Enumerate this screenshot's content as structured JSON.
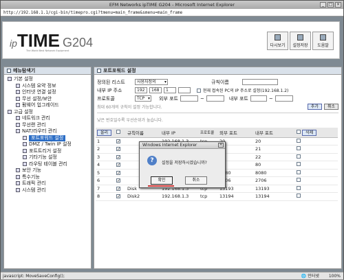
{
  "window": {
    "title": "EFM Networks ipTIME G204 - Microsoft Internet Explorer"
  },
  "address": {
    "url": "http://192.168.1.1/cgi-bin/timepro.cgi?tmenu=main_frame&smenu=main_frame"
  },
  "brand": {
    "ip": "ip",
    "time": "TIME",
    "model": "G204",
    "tagline": "The World Best Network Equipment"
  },
  "header_buttons": [
    {
      "label": "다시보기"
    },
    {
      "label": "설정저장"
    },
    {
      "label": "도움말"
    }
  ],
  "sidebar": {
    "title": "메뉴탐색기",
    "items": [
      {
        "label": "기본 설정",
        "level": 1
      },
      {
        "label": "시스템 요약 정보",
        "level": 2
      },
      {
        "label": "인터넷 연결 설정",
        "level": 2
      },
      {
        "label": "무선 설정/보안",
        "level": 2
      },
      {
        "label": "펌웨어 업그레이드",
        "level": 2
      },
      {
        "label": "고급 설정",
        "level": 1
      },
      {
        "label": "네트워크 관리",
        "level": 2
      },
      {
        "label": "무선랜 관리",
        "level": 2
      },
      {
        "label": "NAT/라우터 관리",
        "level": 2
      },
      {
        "label": "포트포워드 설정",
        "level": 3,
        "selected": true
      },
      {
        "label": "DMZ / Twin IP 설정",
        "level": 3
      },
      {
        "label": "포트트리거 설정",
        "level": 3
      },
      {
        "label": "기타기능 설정",
        "level": 3
      },
      {
        "label": "라우팅 테이블 관리",
        "level": 3
      },
      {
        "label": "보안 기능",
        "level": 2
      },
      {
        "label": "특수기능",
        "level": 2
      },
      {
        "label": "트래픽 관리",
        "level": 2
      },
      {
        "label": "시스템 관리",
        "level": 2
      }
    ]
  },
  "main": {
    "title": "포트포워드 설정",
    "form": {
      "rule_list_label": "정의된 리스트",
      "rule_list_value": "사용자정의",
      "rule_name_label": "규칙이름",
      "internal_ip_label": "내부 IP 주소",
      "ip_parts": [
        "192",
        "168",
        "1",
        ""
      ],
      "current_pc_label": "현재 접속된 PC의 IP 주소로 설정(192.168.1.2)",
      "protocol_label": "프로토콜",
      "protocol_value": "TCP",
      "external_port_label": "외부 포트",
      "internal_port_label": "내부 포트",
      "port_separator": "~",
      "note": "최대 60개의 규칙이 설정 가능합니다.",
      "add_button": "추가",
      "cancel_button": "취소"
    },
    "priority_note": "낮은 번호일수록 우선순위가 높습니다.",
    "table": {
      "top_button": "올리",
      "delete_button": "삭제",
      "headers": [
        "",
        "",
        "규칙이름",
        "내부 IP",
        "프로토콜",
        "외부 포트",
        "내부 포트",
        ""
      ],
      "rows": [
        {
          "no": "1",
          "name": "",
          "ip": "192.168.1.3",
          "proto": "tcp",
          "ext": "20",
          "int": "20"
        },
        {
          "no": "2",
          "name": "",
          "ip": "192.168.1.3",
          "proto": "tcp",
          "ext": "21",
          "int": "21"
        },
        {
          "no": "3",
          "name": "",
          "ip": "192.168.1.3",
          "proto": "tcp",
          "ext": "22",
          "int": "22"
        },
        {
          "no": "4",
          "name": "",
          "ip": "192.168.1.3",
          "proto": "tcp",
          "ext": "80",
          "int": "80"
        },
        {
          "no": "5",
          "name": "",
          "ip": "192.168.1.3",
          "proto": "tcp",
          "ext": "8080",
          "int": "8080"
        },
        {
          "no": "6",
          "name": "",
          "ip": "192.168.1.3",
          "proto": "tcp",
          "ext": "2706",
          "int": "2706"
        },
        {
          "no": "7",
          "name": "Disk",
          "ip": "192.168.1.3",
          "proto": "tcp",
          "ext": "13193",
          "int": "13193"
        },
        {
          "no": "8",
          "name": "Disk2",
          "ip": "192.168.1.3",
          "proto": "tcp",
          "ext": "13194",
          "int": "13194"
        }
      ]
    }
  },
  "dialog": {
    "title": "Windows Internet Explorer",
    "message": "설정을 저장하시겠습니까?",
    "ok": "확인",
    "cancel": "취소"
  },
  "status": {
    "left": "javascript: MoveSaveConfig();",
    "zone": "인터넷",
    "zoom": "100%"
  }
}
